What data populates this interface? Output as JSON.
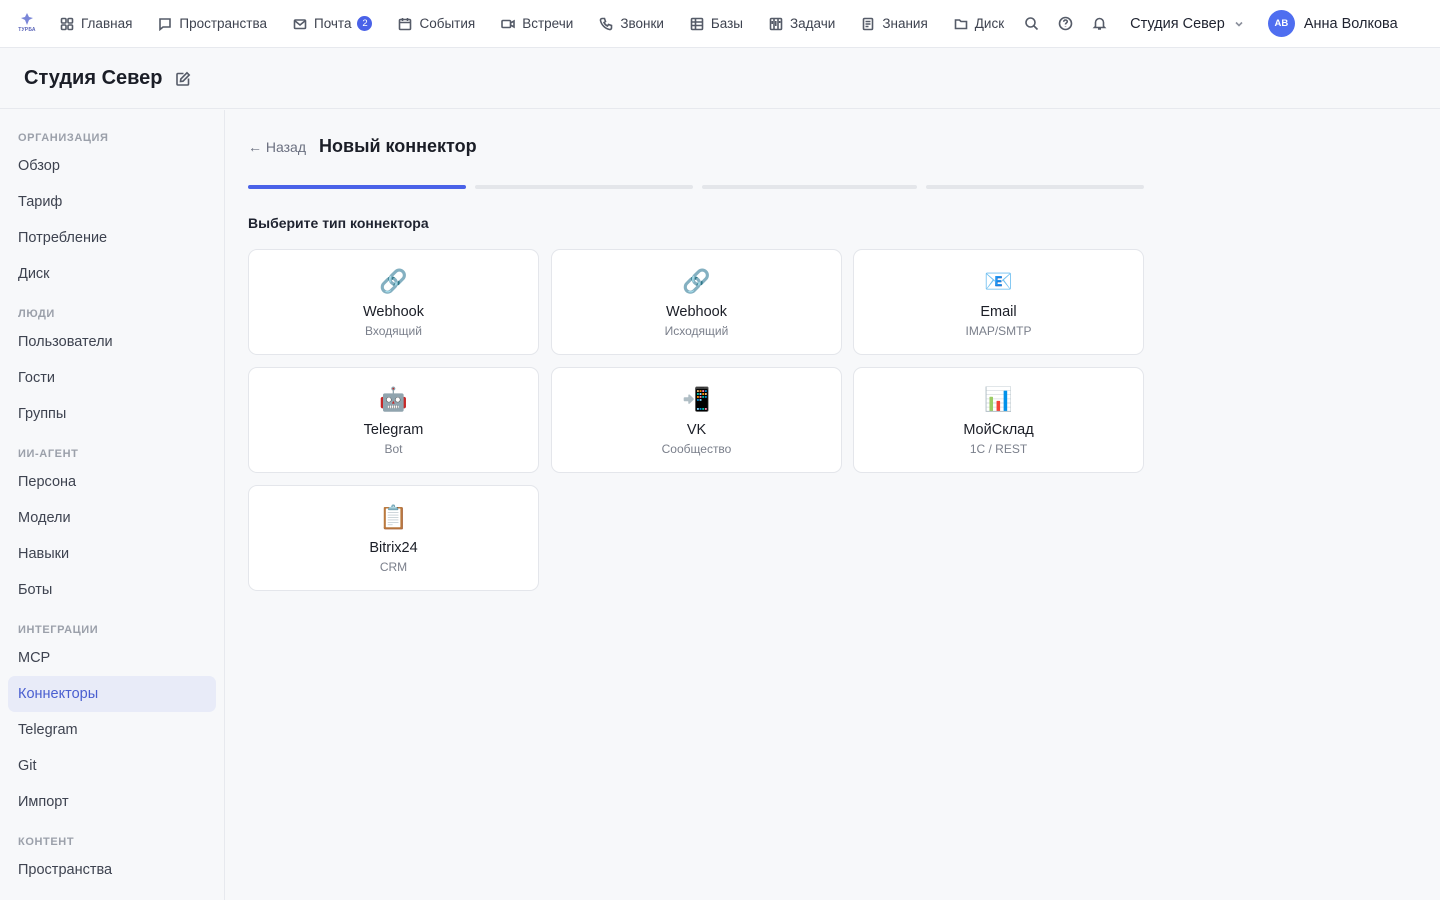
{
  "logo": {
    "text": "ТУРБА"
  },
  "nav": {
    "items": [
      {
        "icon": "grid-icon",
        "label": "Главная"
      },
      {
        "icon": "chat-icon",
        "label": "Пространства"
      },
      {
        "icon": "mail-icon",
        "label": "Почта",
        "badge": "2"
      },
      {
        "icon": "calendar-icon",
        "label": "События"
      },
      {
        "icon": "video-icon",
        "label": "Встречи"
      },
      {
        "icon": "phone-icon",
        "label": "Звонки"
      },
      {
        "icon": "table-icon",
        "label": "Базы"
      },
      {
        "icon": "kanban-icon",
        "label": "Задачи"
      },
      {
        "icon": "book-icon",
        "label": "Знания"
      },
      {
        "icon": "folder-icon",
        "label": "Диск"
      }
    ],
    "org_name": "Студия Север",
    "user": {
      "initials": "АВ",
      "name": "Анна Волкова"
    }
  },
  "header": {
    "title": "Студия Север"
  },
  "sidebar": {
    "sections": [
      {
        "title": "ОРГАНИЗАЦИЯ",
        "items": [
          "Обзор",
          "Тариф",
          "Потребление",
          "Диск"
        ]
      },
      {
        "title": "ЛЮДИ",
        "items": [
          "Пользователи",
          "Гости",
          "Группы"
        ]
      },
      {
        "title": "ИИ-АГЕНТ",
        "items": [
          "Персона",
          "Модели",
          "Навыки",
          "Боты"
        ]
      },
      {
        "title": "ИНТЕГРАЦИИ",
        "items": [
          "MCP",
          "Коннекторы",
          "Telegram",
          "Git",
          "Импорт"
        ]
      },
      {
        "title": "КОНТЕНТ",
        "items": [
          "Пространства"
        ]
      }
    ],
    "active_item": "Коннекторы"
  },
  "main": {
    "back_label": "← Назад",
    "title": "Новый коннектор",
    "steps_total": 4,
    "step_current": 1,
    "choose_label": "Выберите тип коннектора",
    "connectors": [
      {
        "emoji": "🔗",
        "icon": "link-icon",
        "name": "Webhook",
        "sub": "Входящий"
      },
      {
        "emoji": "🔗",
        "icon": "link-icon",
        "name": "Webhook",
        "sub": "Исходящий"
      },
      {
        "emoji": "📧",
        "icon": "email-icon",
        "name": "Email",
        "sub": "IMAP/SMTP"
      },
      {
        "emoji": "🤖",
        "icon": "robot-icon",
        "name": "Telegram",
        "sub": "Bot"
      },
      {
        "emoji": "📲",
        "icon": "mobile-icon",
        "name": "VK",
        "sub": "Сообщество"
      },
      {
        "emoji": "📊",
        "icon": "bar-chart-icon",
        "name": "МойСклад",
        "sub": "1С / REST"
      },
      {
        "emoji": "📋",
        "icon": "clipboard-icon",
        "name": "Bitrix24",
        "sub": "CRM"
      }
    ]
  },
  "colors": {
    "accent": "#4a62e8",
    "active_bg": "#e8ebf8",
    "active_text": "#4a5fd0"
  }
}
